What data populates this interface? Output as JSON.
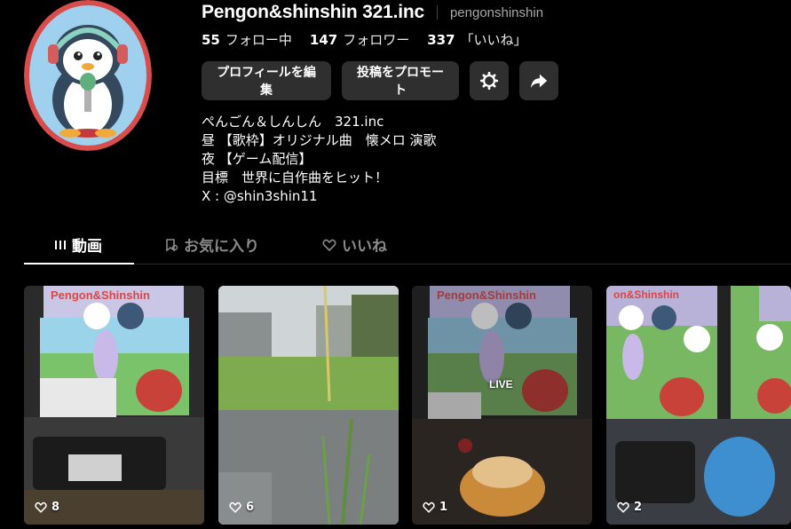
{
  "profile": {
    "display_name": "Pengon&shinshin 321.inc",
    "username": "pengonshinshin",
    "avatar_label": "penguin-with-headphones-microphone"
  },
  "stats": [
    {
      "value": "55",
      "label": "フォロー中"
    },
    {
      "value": "147",
      "label": "フォロワー"
    },
    {
      "value": "337",
      "label": "「いいね」"
    }
  ],
  "actions": {
    "edit_profile": "プロフィールを編集",
    "promote_post": "投稿をプロモート",
    "settings_icon": "gear-icon",
    "share_icon": "share-arrow-icon"
  },
  "bio": [
    "ぺんごん＆しんしん　321.inc",
    "昼 【歌枠】オリジナル曲　懐メロ 演歌",
    "夜 【ゲーム配信】",
    "目標　世界に自作曲をヒット！",
    "X : @shin3shin11"
  ],
  "tabs": [
    {
      "label": "動画",
      "icon": "grid-bars-icon",
      "active": true
    },
    {
      "label": "お気に入り",
      "icon": "bookmark-icon",
      "active": false
    },
    {
      "label": "いいね",
      "icon": "heart-lock-icon",
      "active": false
    }
  ],
  "videos": [
    {
      "likes": "8",
      "badge": "",
      "scene": "game-overlay-keyboard"
    },
    {
      "likes": "6",
      "badge": "",
      "scene": "rainy-road"
    },
    {
      "likes": "1",
      "badge": "LIVE",
      "scene": "game-overlay-dessert"
    },
    {
      "likes": "2",
      "badge": "",
      "scene": "game-overlay-controller"
    }
  ],
  "colors": {
    "background": "#000000",
    "button_bg": "#2f2f2f",
    "muted_text": "#a8a8a8",
    "avatar_ring": "#d9534f"
  }
}
